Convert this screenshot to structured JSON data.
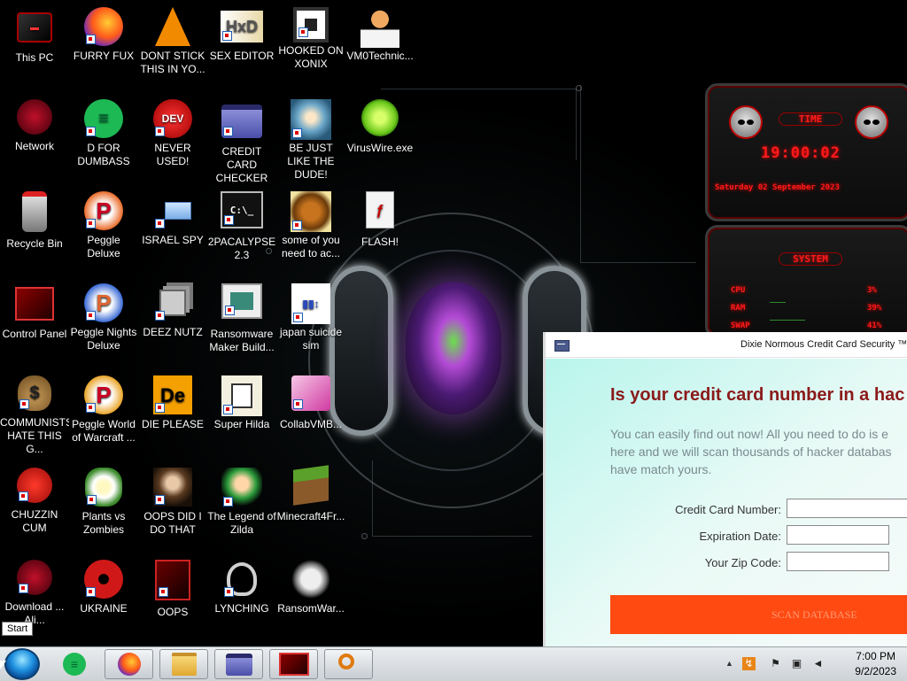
{
  "desktop": {
    "icons": [
      {
        "label": "This PC"
      },
      {
        "label": "FURRY FUX"
      },
      {
        "label": "DONT STICK THIS IN YO..."
      },
      {
        "label": "SEX EDITOR"
      },
      {
        "label": "HOOKED ON XONIX"
      },
      {
        "label": "VM0Technic..."
      },
      {
        "label": "Network"
      },
      {
        "label": "D FOR DUMBASS"
      },
      {
        "label": "NEVER USED!"
      },
      {
        "label": "CREDIT CARD CHECKER"
      },
      {
        "label": "BE JUST LIKE THE DUDE!"
      },
      {
        "label": "VirusWire.exe"
      },
      {
        "label": "Recycle Bin"
      },
      {
        "label": "Peggle Deluxe"
      },
      {
        "label": "ISRAEL SPY"
      },
      {
        "label": "2PACALYPSE 2.3"
      },
      {
        "label": "some of you need to ac..."
      },
      {
        "label": "FLASH!"
      },
      {
        "label": "Control Panel"
      },
      {
        "label": "Peggle Nights Deluxe"
      },
      {
        "label": "DEEZ NUTZ"
      },
      {
        "label": "Ransomware Maker Build..."
      },
      {
        "label": "japan suicide sim"
      },
      {
        "label": "COMMUNISTS HATE THIS G..."
      },
      {
        "label": "Peggle World of Warcraft ..."
      },
      {
        "label": "DIE PLEASE"
      },
      {
        "label": "Super Hilda"
      },
      {
        "label": "CollabVMB..."
      },
      {
        "label": "CHUZZIN CUM"
      },
      {
        "label": "Plants vs Zombies"
      },
      {
        "label": "OOPS DID I DO THAT"
      },
      {
        "label": "The Legend of Zilda"
      },
      {
        "label": "Minecraft4Fr..."
      },
      {
        "label": "Download ... Ali..."
      },
      {
        "label": "UKRAINE"
      },
      {
        "label": "OOPS"
      },
      {
        "label": "LYNCHING"
      },
      {
        "label": "RansomWar..."
      }
    ]
  },
  "gadgets": {
    "clock": {
      "title": "TIME",
      "time": "19:00:02",
      "date": "Saturday 02 September 2023"
    },
    "system": {
      "title": "SYSTEM",
      "rows": [
        {
          "label": "CPU",
          "value": "3%"
        },
        {
          "label": "RAM",
          "value": "39%"
        },
        {
          "label": "SWAP",
          "value": "41%"
        }
      ]
    }
  },
  "window": {
    "title": "Dixie Normous Credit Card Security ™",
    "headline": "Is your credit card number in a hac",
    "description": [
      "You can easily find out now! All you need to do is e",
      "here and we will scan thousands of hacker databas",
      "have match yours."
    ],
    "fields": {
      "card_label": "Credit Card Number:",
      "card_value": "",
      "expiry_label": "Expiration Date:",
      "expiry_value": "",
      "zip_label": "Your Zip Code:",
      "zip_value": ""
    },
    "scan_button": "SCAN DATABASE"
  },
  "taskbar": {
    "start_tooltip": "Start",
    "clock_time": "7:00 PM",
    "clock_date": "9/2/2023"
  },
  "colors": {
    "headline": "#8b1a1a",
    "scan_button": "#ff4a12",
    "gadget_red": "#ff1a1a"
  }
}
